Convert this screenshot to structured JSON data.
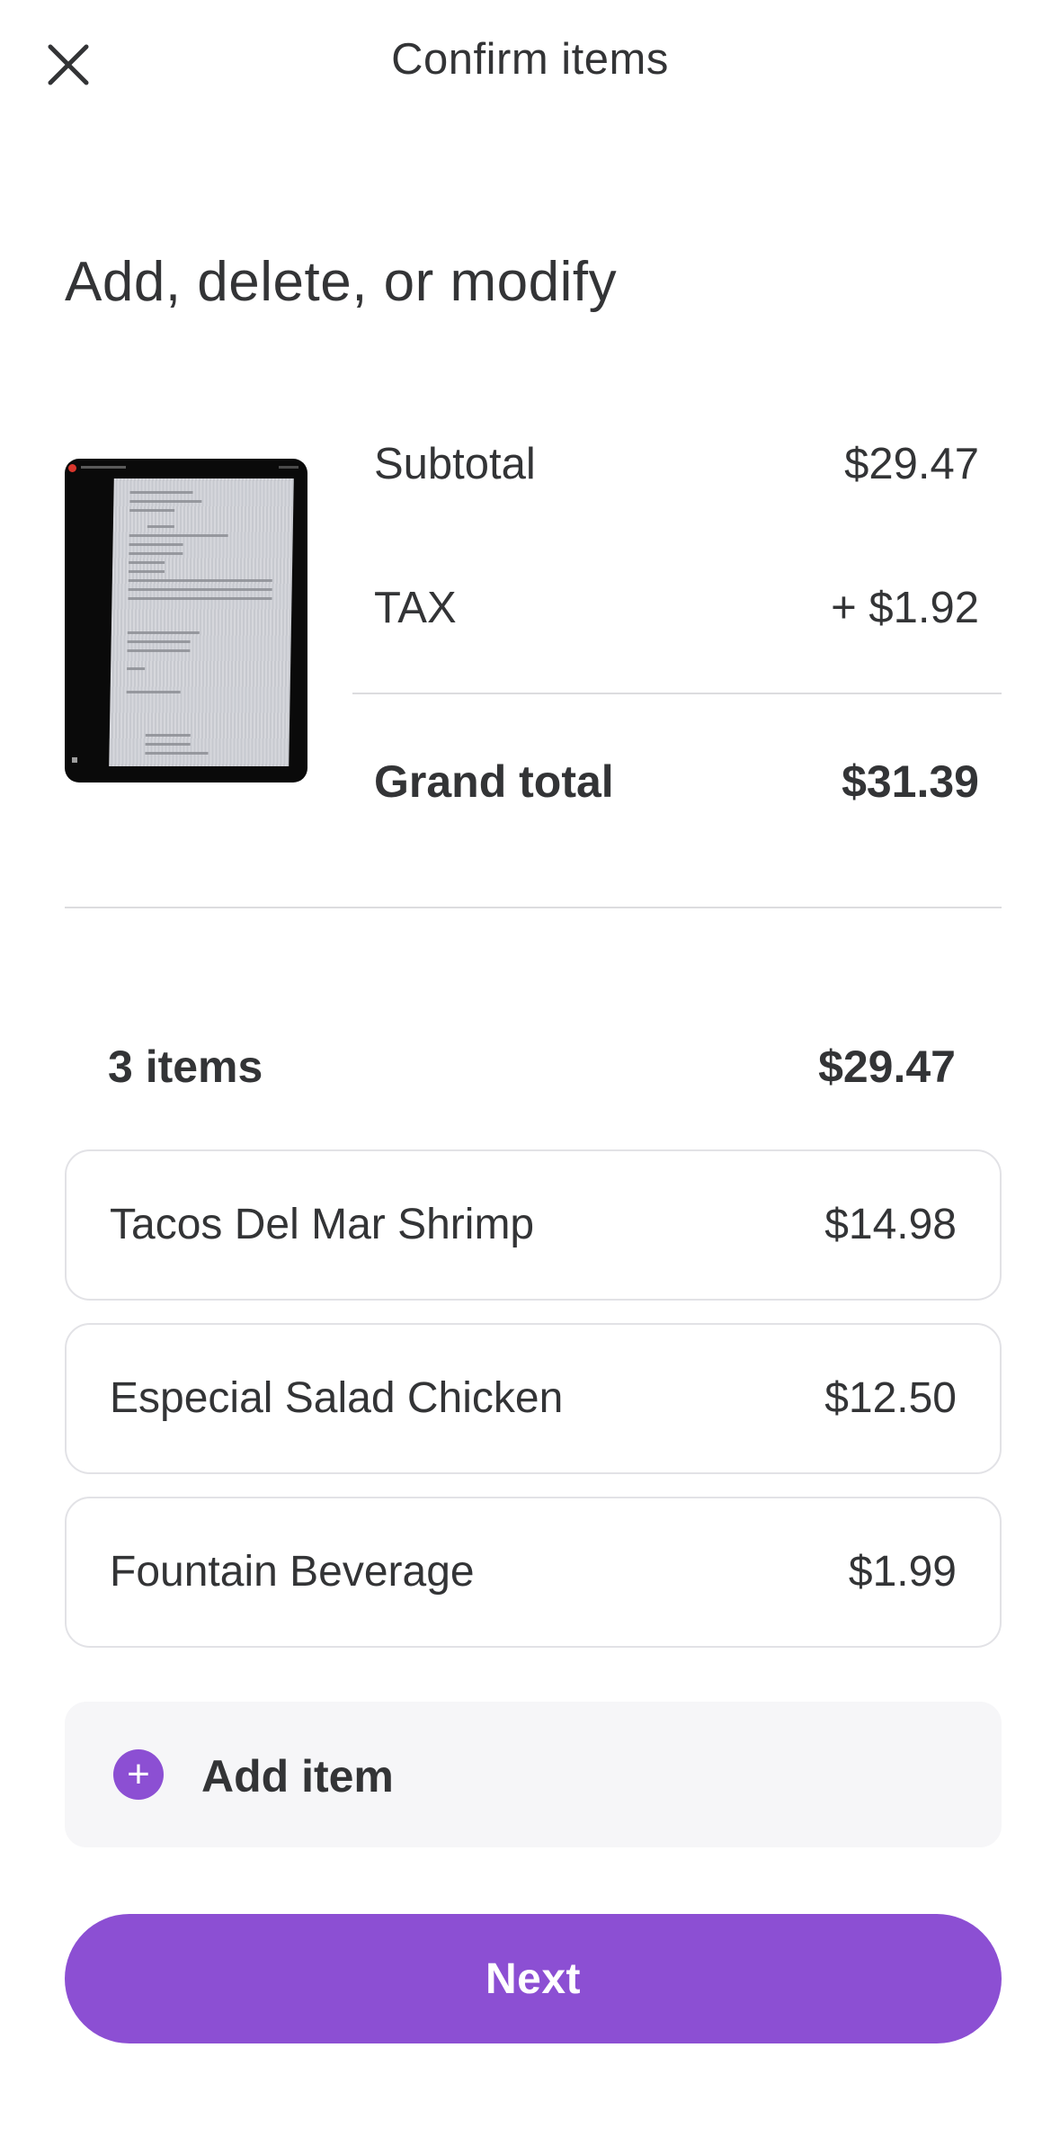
{
  "header": {
    "title": "Confirm items",
    "close_icon": "close-icon"
  },
  "section_title": "Add, delete, or modify",
  "summary": {
    "subtotal_label": "Subtotal",
    "subtotal_value": "$29.47",
    "tax_label": "TAX",
    "tax_value": "+ $1.92",
    "grand_total_label": "Grand total",
    "grand_total_value": "$31.39"
  },
  "items_header": {
    "count_label": "3 items",
    "total": "$29.47"
  },
  "items": [
    {
      "name": "Tacos Del Mar Shrimp",
      "price": "$14.98"
    },
    {
      "name": "Especial Salad Chicken",
      "price": "$12.50"
    },
    {
      "name": "Fountain Beverage",
      "price": "$1.99"
    }
  ],
  "add_item": {
    "label": "Add item",
    "icon": "plus-icon"
  },
  "next_button": {
    "label": "Next"
  },
  "colors": {
    "accent": "#8c4fd3",
    "text": "#333436",
    "divider": "#dcdcdf",
    "card_border": "#e2e2e6",
    "add_bg": "#f6f6f8"
  }
}
